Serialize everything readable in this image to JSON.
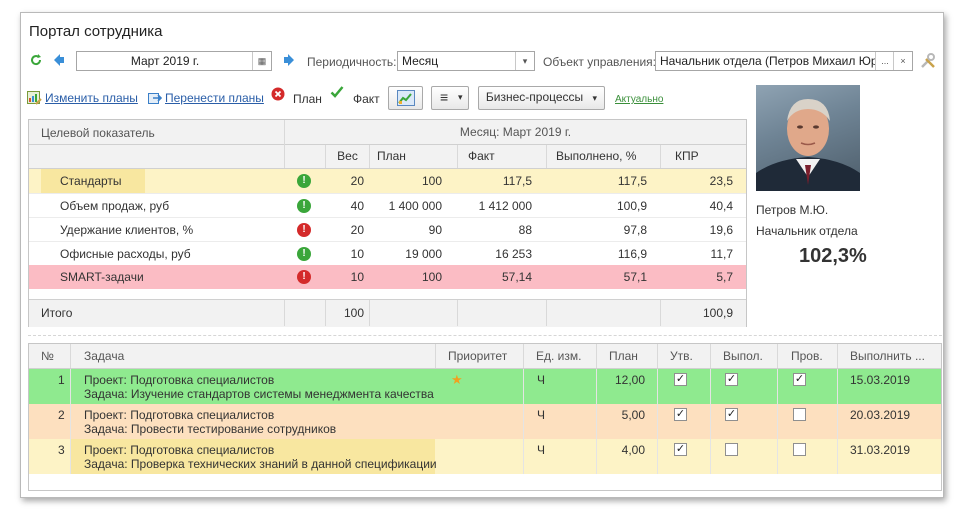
{
  "window": {
    "title": "Портал сотрудника"
  },
  "toolbar": {
    "period_value": "Март 2019 г.",
    "periodicity_label": "Периодичность:",
    "periodicity_value": "Месяц",
    "object_label": "Объект управления:",
    "object_value": "Начальник отдела (Петров Михаил Юрье",
    "object_more": "...",
    "object_clear": "×"
  },
  "actions": {
    "change_plans": "Изменить планы",
    "move_plans": "Перенести планы",
    "plan_label": "План",
    "fact_label": "Факт",
    "business_processes": "Бизнес-процессы",
    "actual_label": "Актуально"
  },
  "kpi_table": {
    "header_indicator": "Целевой показатель",
    "header_month": "Месяц: Март 2019 г.",
    "columns": [
      "Вес",
      "План",
      "Факт",
      "Выполнено, %",
      "КПР"
    ],
    "rows": [
      {
        "name": "Стандарты",
        "status": "ok",
        "weight": "20",
        "plan": "100",
        "fact": "117,5",
        "done": "117,5",
        "kpr": "23,5"
      },
      {
        "name": "Объем продаж, руб",
        "status": "ok",
        "weight": "40",
        "plan": "1 400 000",
        "fact": "1 412 000",
        "done": "100,9",
        "kpr": "40,4"
      },
      {
        "name": "Удержание клиентов, %",
        "status": "bad",
        "weight": "20",
        "plan": "90",
        "fact": "88",
        "done": "97,8",
        "kpr": "19,6"
      },
      {
        "name": "Офисные расходы, руб",
        "status": "ok",
        "weight": "10",
        "plan": "19 000",
        "fact": "16 253",
        "done": "116,9",
        "kpr": "11,7"
      },
      {
        "name": "SMART-задачи",
        "status": "bad",
        "weight": "10",
        "plan": "100",
        "fact": "57,14",
        "done": "57,1",
        "kpr": "5,7"
      }
    ],
    "total_label": "Итого",
    "total_weight": "100",
    "total_kpr": "100,9"
  },
  "employee": {
    "name": "Петров М.Ю.",
    "position": "Начальник отдела",
    "score": "102,3%"
  },
  "tasks_table": {
    "columns": [
      "№",
      "Задача",
      "Приоритет",
      "Ед. изм.",
      "План",
      "Утв.",
      "Выпол.",
      "Пров.",
      "Выполнить ..."
    ],
    "rows": [
      {
        "num": "1",
        "project": "Проект: Подготовка специалистов",
        "task": "Задача: Изучение стандартов системы менеджмента качества",
        "priority": "★",
        "unit": "Ч",
        "plan": "12,00",
        "approved": true,
        "done": true,
        "checked": true,
        "due": "15.03.2019"
      },
      {
        "num": "2",
        "project": "Проект: Подготовка специалистов",
        "task": "Задача: Провести тестирование сотрудников",
        "priority": "",
        "unit": "Ч",
        "plan": "5,00",
        "approved": true,
        "done": true,
        "checked": false,
        "due": "20.03.2019"
      },
      {
        "num": "3",
        "project": "Проект: Подготовка специалистов",
        "task": "Задача: Проверка технических знаний в данной спецификации",
        "priority": "",
        "unit": "Ч",
        "plan": "4,00",
        "approved": true,
        "done": false,
        "checked": false,
        "due": "31.03.2019"
      }
    ]
  },
  "colors": {
    "ok": "#3aa63a",
    "bad": "#d42a2a",
    "row_yellow": "#fdf3c6",
    "row_pink": "#fbbcc4",
    "task_green": "#8fea8f",
    "task_orange": "#fde0bf",
    "task_yellow": "#fdf3c6",
    "link": "#2a5ea8"
  }
}
